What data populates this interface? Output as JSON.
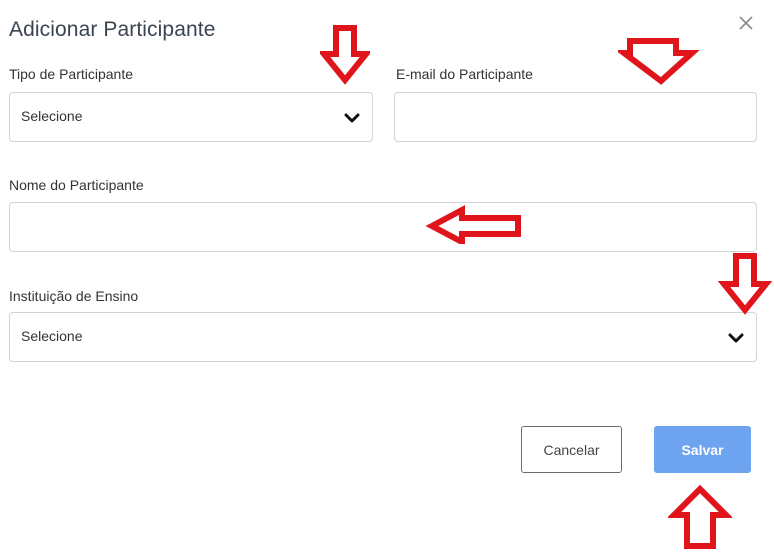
{
  "dialog": {
    "title": "Adicionar Participante",
    "close_icon": "close-icon"
  },
  "fields": {
    "tipo": {
      "label": "Tipo de Participante",
      "value": "Selecione"
    },
    "email": {
      "label": "E-mail do Participante",
      "value": ""
    },
    "nome": {
      "label": "Nome do Participante",
      "value": ""
    },
    "instituicao": {
      "label": "Instituição de Ensino",
      "value": "Selecione"
    }
  },
  "buttons": {
    "cancel_label": "Cancelar",
    "save_label": "Salvar"
  },
  "colors": {
    "primary": "#6ea3ef",
    "annotation_arrow": "#e0151b",
    "border": "#cfd4d9"
  },
  "annotations": {
    "icon": "red-arrow-icon"
  }
}
